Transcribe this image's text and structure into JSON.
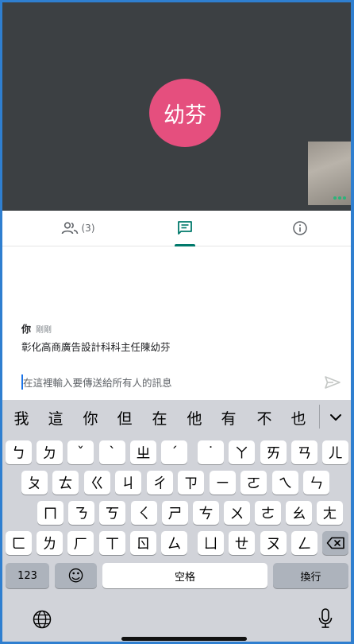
{
  "video": {
    "participant_initials": "幼芬",
    "avatar_color": "#e54f7e",
    "background_color": "#3c4043"
  },
  "tabs": {
    "people_count": "(3)",
    "active_tab": "chat",
    "accent_color": "#00796b",
    "icons": [
      "people-icon",
      "chat-icon",
      "info-icon"
    ]
  },
  "message": {
    "sender": "你",
    "time": "剛剛",
    "text": "彰化高商廣告設計科科主任陳幼芬"
  },
  "composer": {
    "placeholder": "在這裡輸入要傳送給所有人的訊息"
  },
  "keyboard": {
    "candidates": [
      "我",
      "這",
      "你",
      "但",
      "在",
      "他",
      "有",
      "不",
      "也"
    ],
    "row1": [
      "ㄅ",
      "ㄉ",
      "ˇ",
      "ˋ",
      "ㄓ",
      "ˊ",
      "˙",
      "ㄚ",
      "ㄞ",
      "ㄢ",
      "ㄦ"
    ],
    "row2": [
      "ㄆ",
      "ㄊ",
      "ㄍ",
      "ㄐ",
      "ㄔ",
      "ㄗ",
      "ㄧ",
      "ㄛ",
      "ㄟ",
      "ㄣ"
    ],
    "row3": [
      "ㄇ",
      "ㄋ",
      "ㄎ",
      "ㄑ",
      "ㄕ",
      "ㄘ",
      "ㄨ",
      "ㄜ",
      "ㄠ",
      "ㄤ"
    ],
    "row4": [
      "ㄈ",
      "ㄌ",
      "ㄏ",
      "ㄒ",
      "ㄖ",
      "ㄙ",
      "ㄩ",
      "ㄝ",
      "ㄡ",
      "ㄥ"
    ],
    "numbers_key": "123",
    "emoji_key": "☺",
    "space_key": "空格",
    "return_key": "換行"
  }
}
